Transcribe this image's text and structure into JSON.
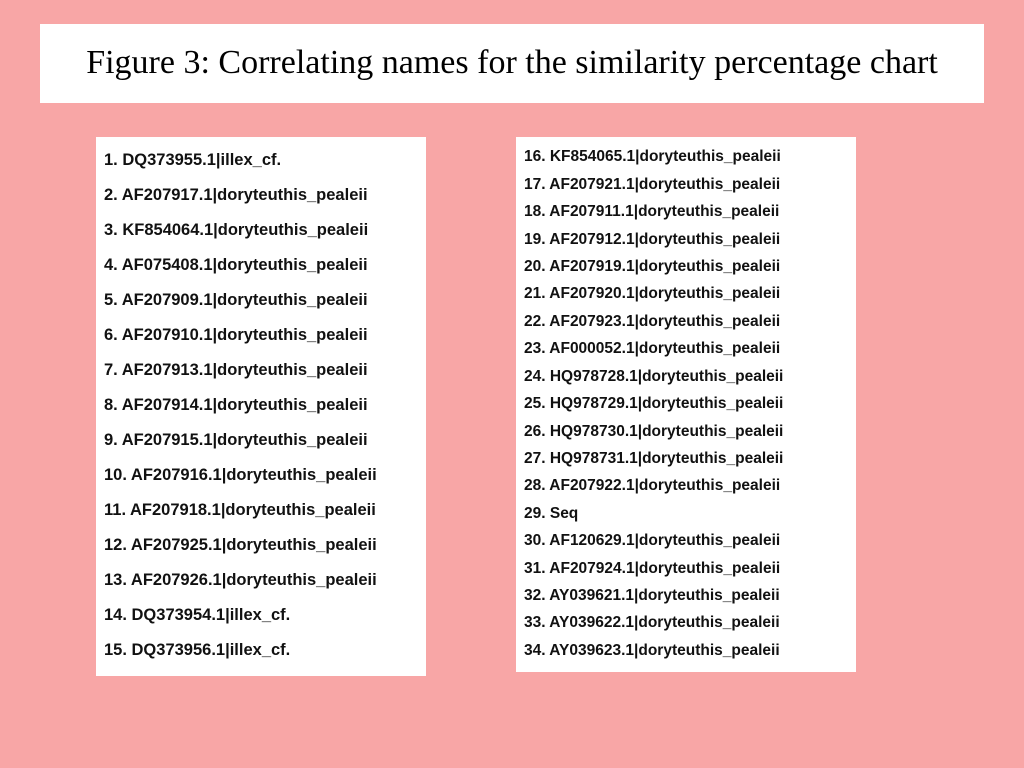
{
  "title": "Figure 3: Correlating names for the similarity percentage chart",
  "left": [
    "1. DQ373955.1|illex_cf.",
    "2. AF207917.1|doryteuthis_pealeii",
    "3. KF854064.1|doryteuthis_pealeii",
    "4. AF075408.1|doryteuthis_pealeii",
    "5. AF207909.1|doryteuthis_pealeii",
    "6. AF207910.1|doryteuthis_pealeii",
    "7. AF207913.1|doryteuthis_pealeii",
    "8. AF207914.1|doryteuthis_pealeii",
    "9. AF207915.1|doryteuthis_pealeii",
    "10. AF207916.1|doryteuthis_pealeii",
    "11. AF207918.1|doryteuthis_pealeii",
    "12. AF207925.1|doryteuthis_pealeii",
    "13. AF207926.1|doryteuthis_pealeii",
    "14. DQ373954.1|illex_cf.",
    "15. DQ373956.1|illex_cf."
  ],
  "right": [
    "16. KF854065.1|doryteuthis_pealeii",
    "17. AF207921.1|doryteuthis_pealeii",
    "18. AF207911.1|doryteuthis_pealeii",
    "19. AF207912.1|doryteuthis_pealeii",
    "20. AF207919.1|doryteuthis_pealeii",
    "21. AF207920.1|doryteuthis_pealeii",
    "22. AF207923.1|doryteuthis_pealeii",
    "23. AF000052.1|doryteuthis_pealeii",
    "24. HQ978728.1|doryteuthis_pealeii",
    "25. HQ978729.1|doryteuthis_pealeii",
    "26. HQ978730.1|doryteuthis_pealeii",
    "27. HQ978731.1|doryteuthis_pealeii",
    "28. AF207922.1|doryteuthis_pealeii",
    "29. Seq",
    "30. AF120629.1|doryteuthis_pealeii",
    "31. AF207924.1|doryteuthis_pealeii",
    "32. AY039621.1|doryteuthis_pealeii",
    "33. AY039622.1|doryteuthis_pealeii",
    "34. AY039623.1|doryteuthis_pealeii"
  ]
}
